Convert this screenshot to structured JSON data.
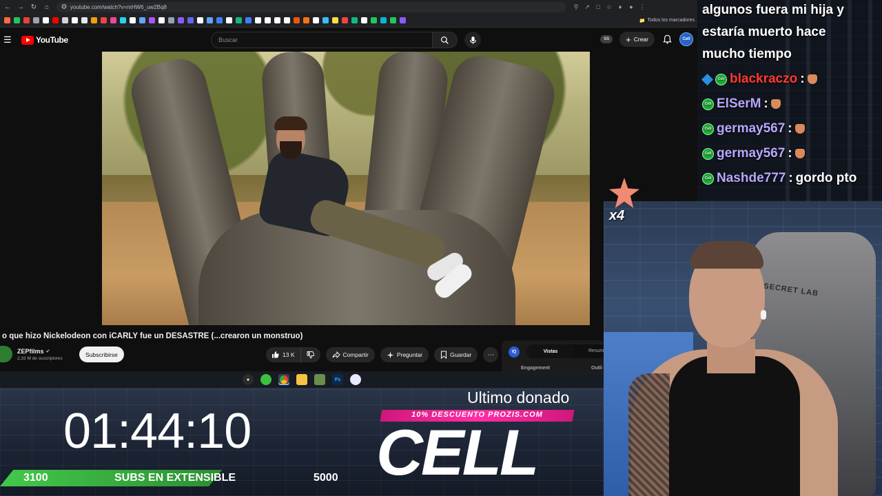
{
  "browser": {
    "url": "youtube.com/watch?v=mHW6_uw2Bq8",
    "bookmarks_folder": "Todos los marcadores",
    "bookmark_colors": [
      "#ff6a3d",
      "#22c55e",
      "#ea4335",
      "#9ca3af",
      "#ffffff",
      "#ff0000",
      "#d1d5db",
      "#ffffff",
      "#e5e7eb",
      "#f59e0b",
      "#ef4444",
      "#ec4899",
      "#22d3ee",
      "#ffffff",
      "#60a5fa",
      "#a855f7",
      "#ffffff",
      "#94a3b8",
      "#8b5cf6",
      "#6366f1",
      "#ffffff",
      "#60a5fa",
      "#3b82f6",
      "#ffffff",
      "#10b981",
      "#3b82f6",
      "#ffffff",
      "#ffffff",
      "#ffffff",
      "#ffffff",
      "#ea580c",
      "#f97316",
      "#ffffff",
      "#38bdf8",
      "#fde047",
      "#ef4444",
      "#10b981",
      "#ffffff",
      "#22c55e",
      "#06b6d4",
      "#22c55e",
      "#8b5cf6"
    ]
  },
  "youtube": {
    "logo_text": "YouTube",
    "search_placeholder": "Buscar",
    "premium_badge": "SS",
    "create_label": "Crear",
    "avatar_text": "Cell"
  },
  "video": {
    "title": "o que hizo Nickelodeon con iCARLY fue un DESASTRE (...crearon un monstruo)",
    "channel": "ZEPfilms",
    "subscribers": "2,33 M de suscriptores",
    "subscribe_label": "Subscribirse",
    "likes": "13 K",
    "share_label": "Compartir",
    "ask_label": "Preguntar",
    "save_label": "Guardar"
  },
  "analytics": {
    "icon_text": "IQ",
    "tab_active": "Vistas",
    "tab_2": "Resum",
    "label_engagement": "Engagement",
    "label_outlier": "Outli"
  },
  "overlay": {
    "timer": "01:44:10",
    "bar_current": "3100",
    "bar_label": "SUBS EN EXTENSIBLE",
    "bar_goal": "5000",
    "bar_progress": 0.62,
    "donor_heading": "Ultimo donado",
    "promo": "10% DESCUENTO PROZIS.COM",
    "donor_name": "CELL",
    "sub_multiplier": "x4"
  },
  "chat": {
    "message_tail_1": "algunos fuera mi hija y",
    "message_tail_2": "estaría muerto hace",
    "message_tail_3": "mucho tiempo",
    "lines": [
      {
        "user": "blackraczo",
        "color": "#ff3b30",
        "text": ""
      },
      {
        "user": "ElSerM",
        "color": "#b7a8ff",
        "text": ""
      },
      {
        "user": "germay567",
        "color": "#b7a8ff",
        "text": ""
      },
      {
        "user": "germay567",
        "color": "#b7a8ff",
        "text": ""
      },
      {
        "user": "Nashde777",
        "color": "#b7a8ff",
        "text": "gordo pto"
      }
    ],
    "badge_text": "Cell"
  },
  "webcam": {
    "chair_brand": "SECRET LAB"
  }
}
